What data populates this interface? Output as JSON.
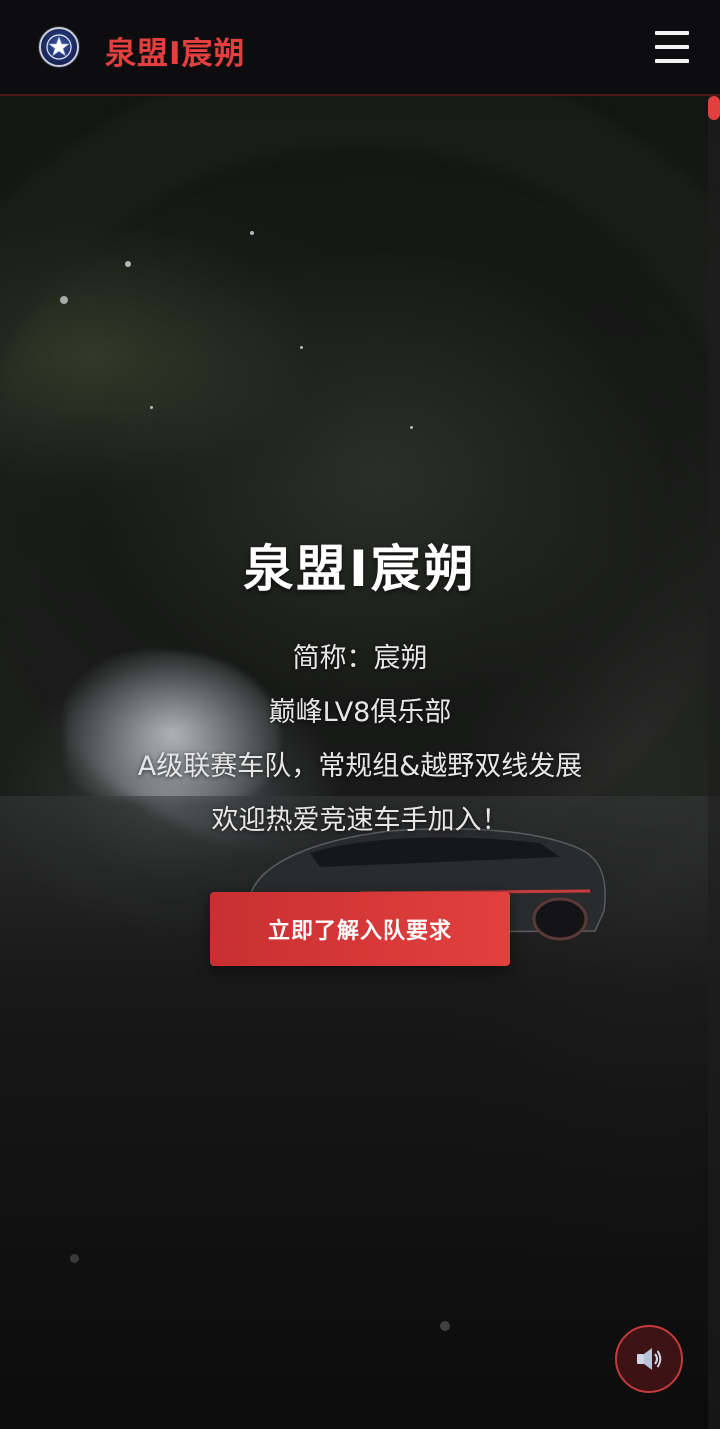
{
  "header": {
    "brand": "泉盟I宸朔",
    "logo_icon": "team-star-emblem",
    "menu_icon": "hamburger-menu-icon"
  },
  "hero": {
    "title": "泉盟I宸朔",
    "lines": [
      "简称：宸朔",
      "巅峰LV8俱乐部",
      "A级联赛车队，常规组&越野双线发展",
      "欢迎热爱竞速车手加入！"
    ],
    "cta_label": "立即了解入队要求"
  },
  "controls": {
    "sound_icon": "speaker-icon"
  },
  "colors": {
    "accent": "#e2403f",
    "header_bg": "#0d0d10",
    "text": "#ffffff"
  }
}
